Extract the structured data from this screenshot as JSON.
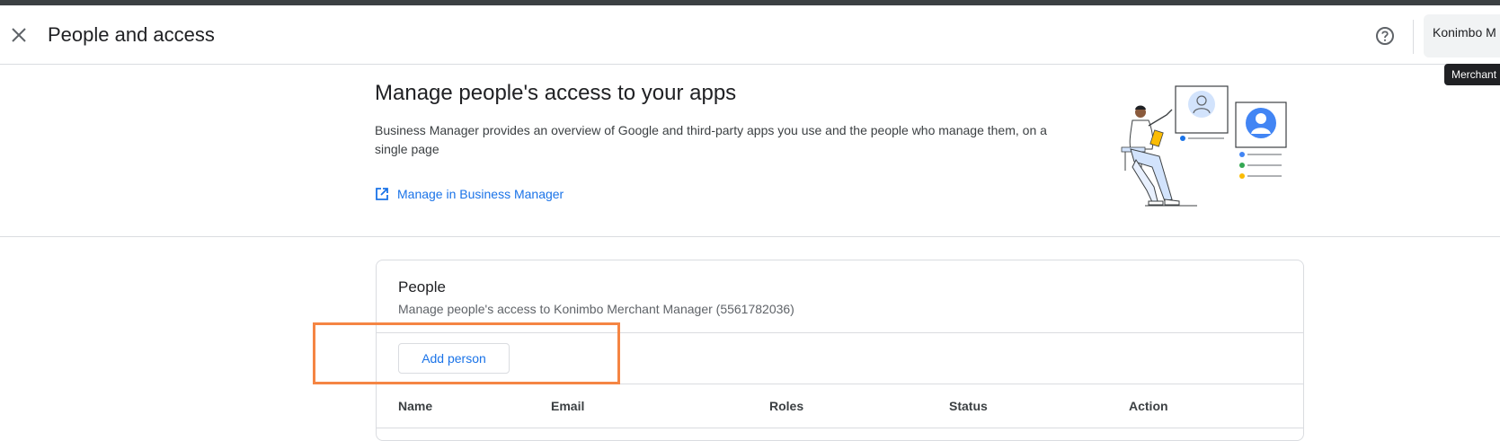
{
  "header": {
    "title": "People and access",
    "account_name": "Konimbo M",
    "tooltip": "Merchant"
  },
  "hero": {
    "title": "Manage people's access to your apps",
    "description": "Business Manager provides an overview of Google and third-party apps you use and the people who manage them, on a single page",
    "link_label": "Manage in Business Manager"
  },
  "people": {
    "title": "People",
    "subtitle": "Manage people's access to Konimbo Merchant Manager (5561782036)",
    "add_button": "Add person",
    "columns": [
      "Name",
      "Email",
      "Roles",
      "Status",
      "Action"
    ]
  },
  "colors": {
    "accent": "#1a73e8",
    "highlight": "#f58543",
    "top_strip": "#3c4043"
  },
  "icons": {
    "close": "close-icon",
    "help": "help-circle-icon",
    "external_link": "open-in-new-icon"
  }
}
